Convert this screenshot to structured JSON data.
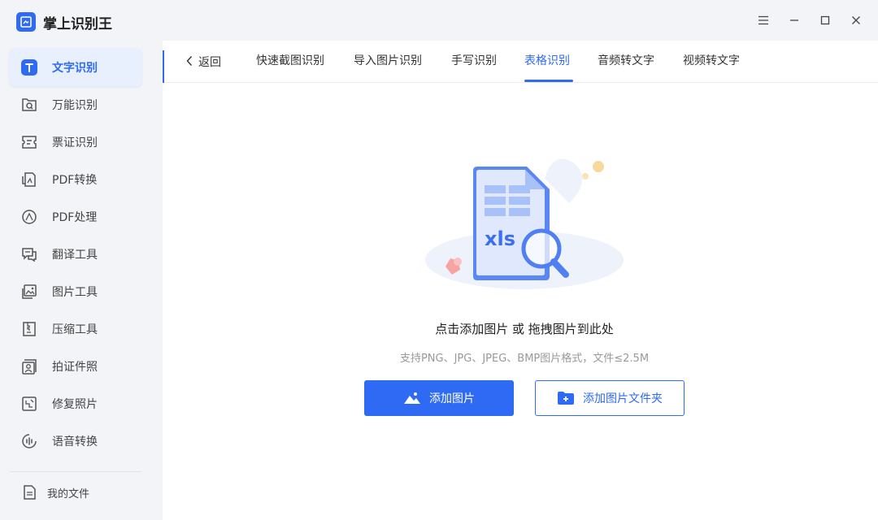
{
  "app": {
    "title": "掌上识别王"
  },
  "sidebar": {
    "items": [
      {
        "label": "文字识别",
        "icon": "text-recognition-icon",
        "active": true
      },
      {
        "label": "万能识别",
        "icon": "universal-scan-icon"
      },
      {
        "label": "票证识别",
        "icon": "ticket-icon"
      },
      {
        "label": "PDF转换",
        "icon": "pdf-convert-icon"
      },
      {
        "label": "PDF处理",
        "icon": "pdf-process-icon"
      },
      {
        "label": "翻译工具",
        "icon": "translate-icon"
      },
      {
        "label": "图片工具",
        "icon": "image-tool-icon"
      },
      {
        "label": "压缩工具",
        "icon": "compress-icon"
      },
      {
        "label": "拍证件照",
        "icon": "id-photo-icon"
      },
      {
        "label": "修复照片",
        "icon": "photo-repair-icon"
      },
      {
        "label": "语音转换",
        "icon": "voice-convert-icon"
      }
    ],
    "my_files": "我的文件"
  },
  "tabs": {
    "back": "返回",
    "items": [
      {
        "label": "快速截图识别"
      },
      {
        "label": "导入图片识别"
      },
      {
        "label": "手写识别"
      },
      {
        "label": "表格识别",
        "active": true
      },
      {
        "label": "音频转文字"
      },
      {
        "label": "视频转文字"
      }
    ]
  },
  "upload": {
    "illustration_text": "xls",
    "title": "点击添加图片 或 拖拽图片到此处",
    "hint": "支持PNG、JPG、JPEG、BMP图片格式，文件≤2.5M",
    "add_image": "添加图片",
    "add_folder": "添加图片文件夹"
  },
  "colors": {
    "accent": "#2f6af5",
    "active_bg": "#e8effd",
    "sidebar_bg": "#f3f4f7"
  }
}
